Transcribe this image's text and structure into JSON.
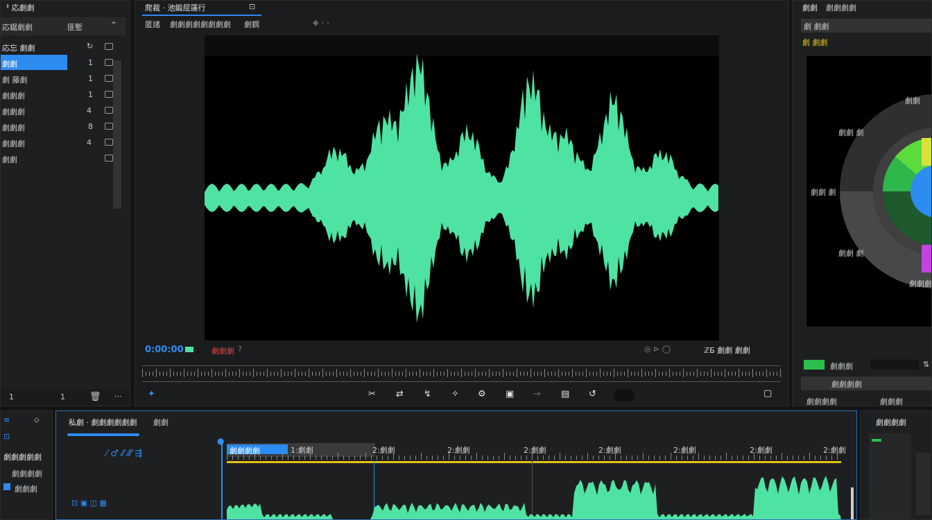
{
  "colors": {
    "accent": "#2d8cf0",
    "waveform": "#4fe3a3",
    "playhead_bar": "#e3c21a",
    "bg": "#141414",
    "panel": "#1e1f20"
  },
  "left_panel": {
    "title": "ᅣ 応劇劇",
    "search_label": "応鋸劇劇",
    "col_label": "匪塹",
    "section_label": "応忘 劇劇",
    "items": [
      {
        "label": "劇劇",
        "count": "1",
        "selected": true
      },
      {
        "label": "劇 藤劇",
        "count": "1",
        "selected": false
      },
      {
        "label": "劇劇劇",
        "count": "1",
        "selected": false
      },
      {
        "label": "劇劇劇",
        "count": "4",
        "selected": false
      },
      {
        "label": "劇劇劇",
        "count": "8",
        "selected": false
      },
      {
        "label": "劇劇劇",
        "count": "4",
        "selected": false
      },
      {
        "label": "劇劇",
        "count": "",
        "selected": false
      }
    ],
    "footer_left": "1",
    "footer_mid": "1"
  },
  "viewer": {
    "tab_label": "爬裁 · 池鍛屈蓮行",
    "subtabs": [
      "匿諸",
      "劇劇劇劇劇劇劇劇",
      "劇鋼"
    ],
    "timecode": "0:00:00",
    "tc_label": "劇劇劇",
    "right_controls": "ℤƂ 劇劇 劇劇"
  },
  "right_panel": {
    "tab1": "劇劇",
    "tab2": "劇劇劇劇",
    "header": "劇 劇劇",
    "subheader": "劇 劇劇",
    "wheel_labels": [
      "劇劇",
      "劇劇 劇",
      "劇劇 劇",
      "劇劇 劇",
      "劇劇劇"
    ],
    "inspector_label": "劇劇劇",
    "inspector_badge": "劇劇",
    "inspector_row2": "劇劇劇劇",
    "inspector_row3": "劇劇劇劇",
    "inspector_row3b": "劇劇劇"
  },
  "timeline": {
    "title": "私劇 · 劇劇劇劇劇劇",
    "title2": "劇劇",
    "clip_label": "劇劇劇劇",
    "ruler_labels": [
      "1:劇劇",
      "2:劇劇",
      "2:劇劇",
      "2:劇劇",
      "2:劇劇",
      "2:劇劇",
      "2:劇劇",
      "2:劇劇"
    ],
    "tools": [
      "劇劇劇劇劇",
      "劇劇劇劇",
      "劇劇劇"
    ]
  },
  "mixer": {
    "title": "劇劇劇劇"
  }
}
